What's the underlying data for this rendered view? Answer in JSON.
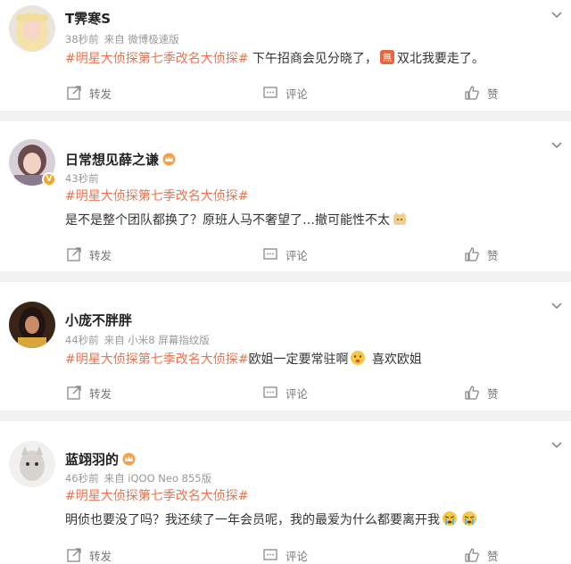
{
  "actions": {
    "repost": "转发",
    "comment": "评论",
    "like": "赞"
  },
  "posts": [
    {
      "username": "T霁寒S",
      "time": "38秒前",
      "source": "来自 微博极速版",
      "hashtag": "#明星大侦探第七季改名大侦探#",
      "text_after_tag": " 下午招商会见分晓了，",
      "text_after_emoji": "双北我要走了。"
    },
    {
      "username": "日常想见薛之谦",
      "time": "43秒前",
      "source": "",
      "hashtag": "#明星大侦探第七季改名大侦探#",
      "line2": "是不是整个团队都换了？原班人马不奢望了…撤可能性不太"
    },
    {
      "username": "小庞不胖胖",
      "time": "44秒前",
      "source": "来自 小米8 屏幕指纹版",
      "hashtag": "#明星大侦探第七季改名大侦探#",
      "text_after_tag": "欧姐一定要常驻啊",
      "text_after_emoji": " 喜欢欧姐"
    },
    {
      "username": "蓝翊羽的",
      "time": "46秒前",
      "source": "来自 iQOO Neo 855版",
      "hashtag": "#明星大侦探第七季改名大侦探#",
      "line2": "明侦也要没了吗？我还续了一年会员呢，我的最爱为什么都要离开我"
    }
  ],
  "colors": {
    "hashtag": "#eb7350",
    "meta": "#999999",
    "background": "#f2f2f2"
  }
}
